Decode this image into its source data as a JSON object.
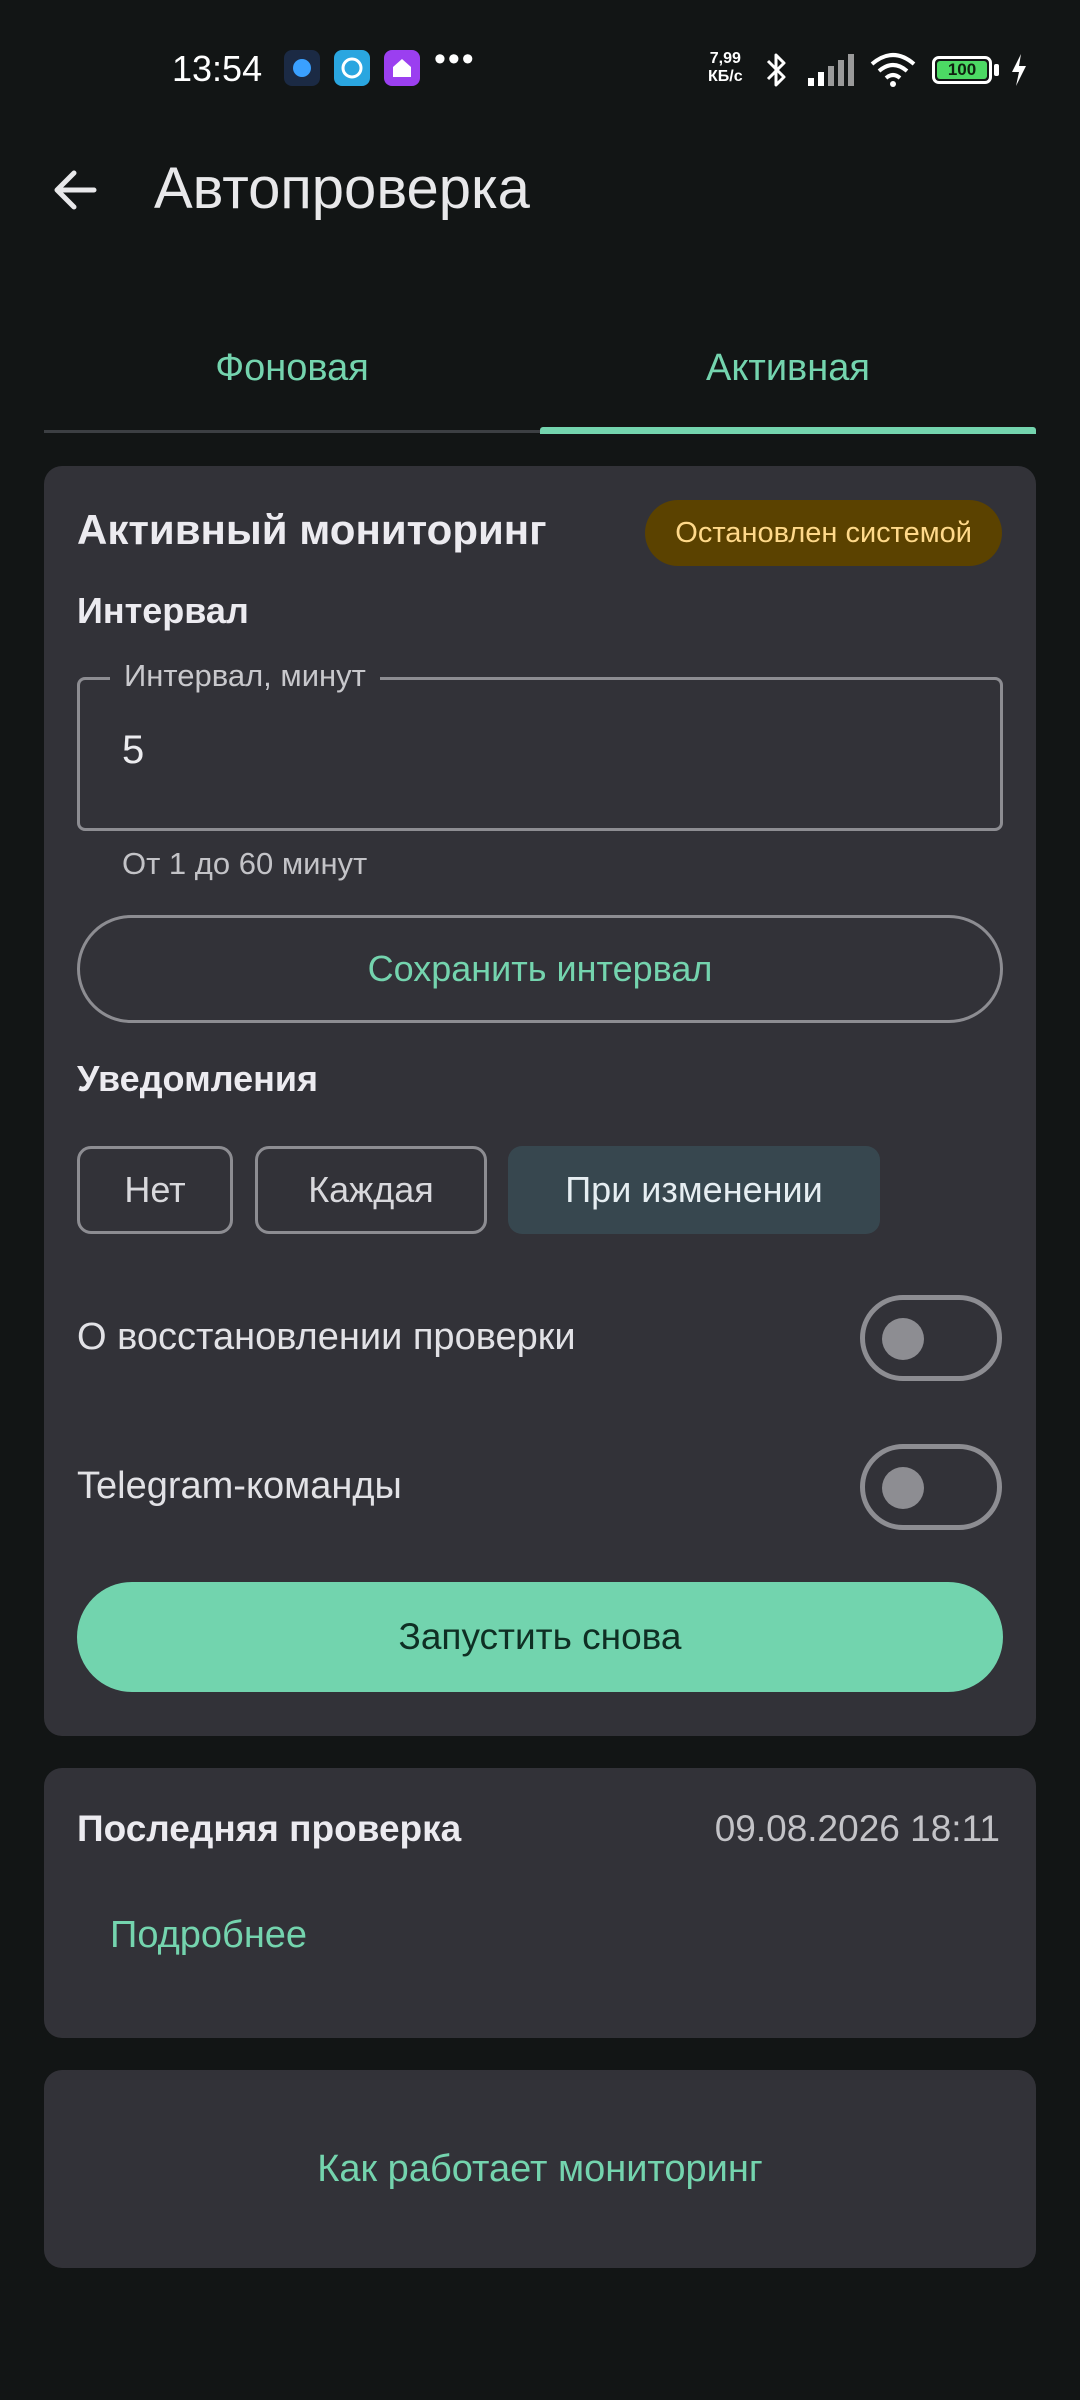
{
  "status_bar": {
    "time": "13:54",
    "net_speed_value": "7,99",
    "net_speed_unit": "КБ/с",
    "battery": "100",
    "icons": [
      "app-icon-blue",
      "app-icon-teal",
      "app-icon-purple",
      "bluetooth-icon",
      "signal-icon",
      "wifi-icon",
      "charging-icon"
    ]
  },
  "app_bar": {
    "title": "Автопроверка",
    "back_icon": "arrow-left-icon"
  },
  "tabs": [
    {
      "label": "Фоновая",
      "selected": false
    },
    {
      "label": "Активная",
      "selected": true
    }
  ],
  "monitoring": {
    "title": "Активный мониторинг",
    "status_badge": "Остановлен системой",
    "interval_section": "Интервал",
    "interval_field": {
      "label": "Интервал, минут",
      "value": "5",
      "helper": "От 1 до 60 минут"
    },
    "save_button": "Сохранить интервал",
    "notifications_section": "Уведомления",
    "notification_options": [
      {
        "label": "Нет",
        "selected": false
      },
      {
        "label": "Каждая",
        "selected": false
      },
      {
        "label": "При изменении",
        "selected": true
      }
    ],
    "toggles": [
      {
        "label": "О восстановлении проверки",
        "on": false
      },
      {
        "label": "Telegram-команды",
        "on": false
      }
    ],
    "start_button": "Запустить снова"
  },
  "last_check": {
    "title": "Последняя проверка",
    "datetime": "09.08.2026 18:11",
    "details_link": "Подробнее"
  },
  "how_it_works_link": "Как работает мониторинг",
  "colors": {
    "background": "#121515",
    "card": "#323238",
    "accent": "#72d4ae",
    "badge_bg": "#5b4200",
    "badge_text": "#ffd98a",
    "chip_selected": "#37474f"
  }
}
